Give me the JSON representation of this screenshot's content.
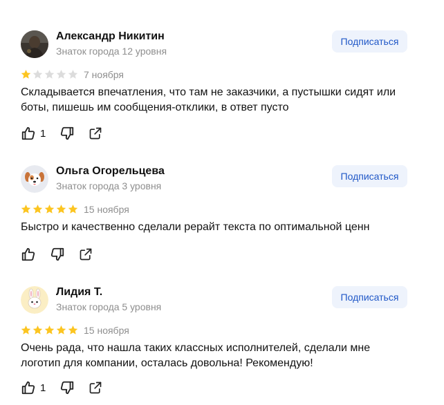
{
  "subscribe_label": "Подписаться",
  "reviews": [
    {
      "name": "Александр Никитин",
      "level": "Знаток города 12 уровня",
      "rating": 1,
      "date": "7 ноября",
      "text": "Складывается впечатления, что там не заказчики, а пустышки сидят или боты, пишешь им сообщения-отклики, в ответ пусто",
      "likes": "1",
      "avatar": "photo-avatar"
    },
    {
      "name": "Ольга Огорельцева",
      "level": "Знаток города 3 уровня",
      "rating": 5,
      "date": "15 ноября",
      "text": "Быстро и качественно сделали рерайт текста по оптимальной ценн",
      "likes": "",
      "avatar": "dog-avatar"
    },
    {
      "name": "Лидия Т.",
      "level": "Знаток города 5 уровня",
      "rating": 5,
      "date": "15 ноября",
      "text": "Очень рада, что нашла таких классных исполнителей, сделали мне логотип для компании, осталась довольна! Рекомендую!",
      "likes": "1",
      "avatar": "bunny-avatar"
    }
  ],
  "colors": {
    "star_on": "#fcc521",
    "star_off": "#dcdcdc",
    "accent": "#1f57c7",
    "button_bg": "#eef3fc"
  }
}
